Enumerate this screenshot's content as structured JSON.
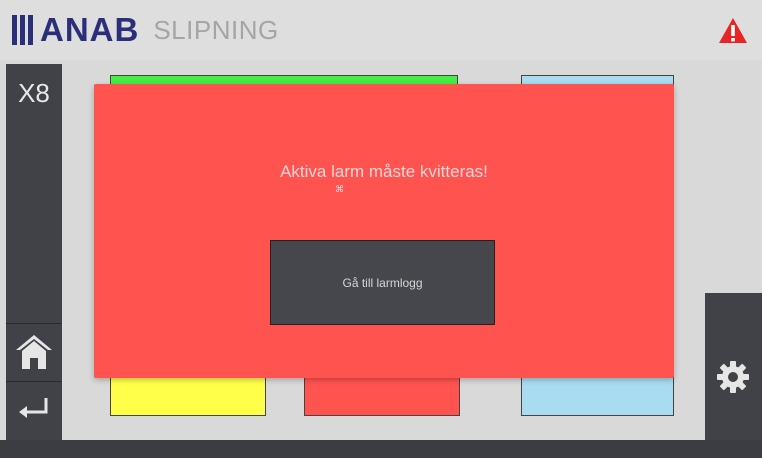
{
  "header": {
    "brand": "ANAB",
    "subtitle": "SLIPNING",
    "brand_color": "#2b2f7a",
    "alert_icon": "warning-triangle-icon"
  },
  "sidebar": {
    "station_label": "X8",
    "buttons": [
      {
        "icon": "home-icon"
      },
      {
        "icon": "return-arrow-icon"
      }
    ]
  },
  "right_panel": {
    "icon": "gear-icon"
  },
  "tiles": {
    "colors": [
      "#44ee44",
      "#a9dcf0",
      "#ffff4a",
      "#ff5350",
      "#a9dcf0"
    ]
  },
  "alarm_dialog": {
    "message": "Aktiva larm måste kvitteras!",
    "mark": "⌘",
    "button_label": "Gå till larmlogg",
    "background": "#ff5350"
  }
}
